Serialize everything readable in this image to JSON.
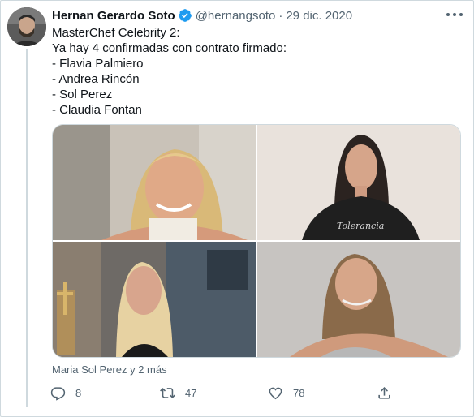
{
  "tweet": {
    "author_name": "Hernan Gerardo Soto",
    "handle": "@hernangsoto",
    "separator": "·",
    "date": "29 dic. 2020",
    "text_lines": [
      "MasterChef Celebrity 2:",
      "Ya hay 4 confirmadas con contrato firmado:",
      "- Flavia Palmiero",
      "- Andrea Rincón",
      "- Sol Perez",
      "- Claudia Fontan"
    ],
    "image_shirt_text": "Tolerancia",
    "tagged_text": "Maria Sol Perez y 2 más",
    "actions": {
      "reply_count": "8",
      "retweet_count": "47",
      "like_count": "78"
    },
    "icons": {
      "verified": "verified-badge-icon",
      "more": "more-options-icon",
      "reply": "reply-icon",
      "retweet": "retweet-icon",
      "like": "like-icon",
      "share": "share-icon"
    },
    "colors": {
      "verified_blue": "#1d9bf0",
      "secondary_text": "#536471",
      "border": "#cfd9de"
    }
  }
}
